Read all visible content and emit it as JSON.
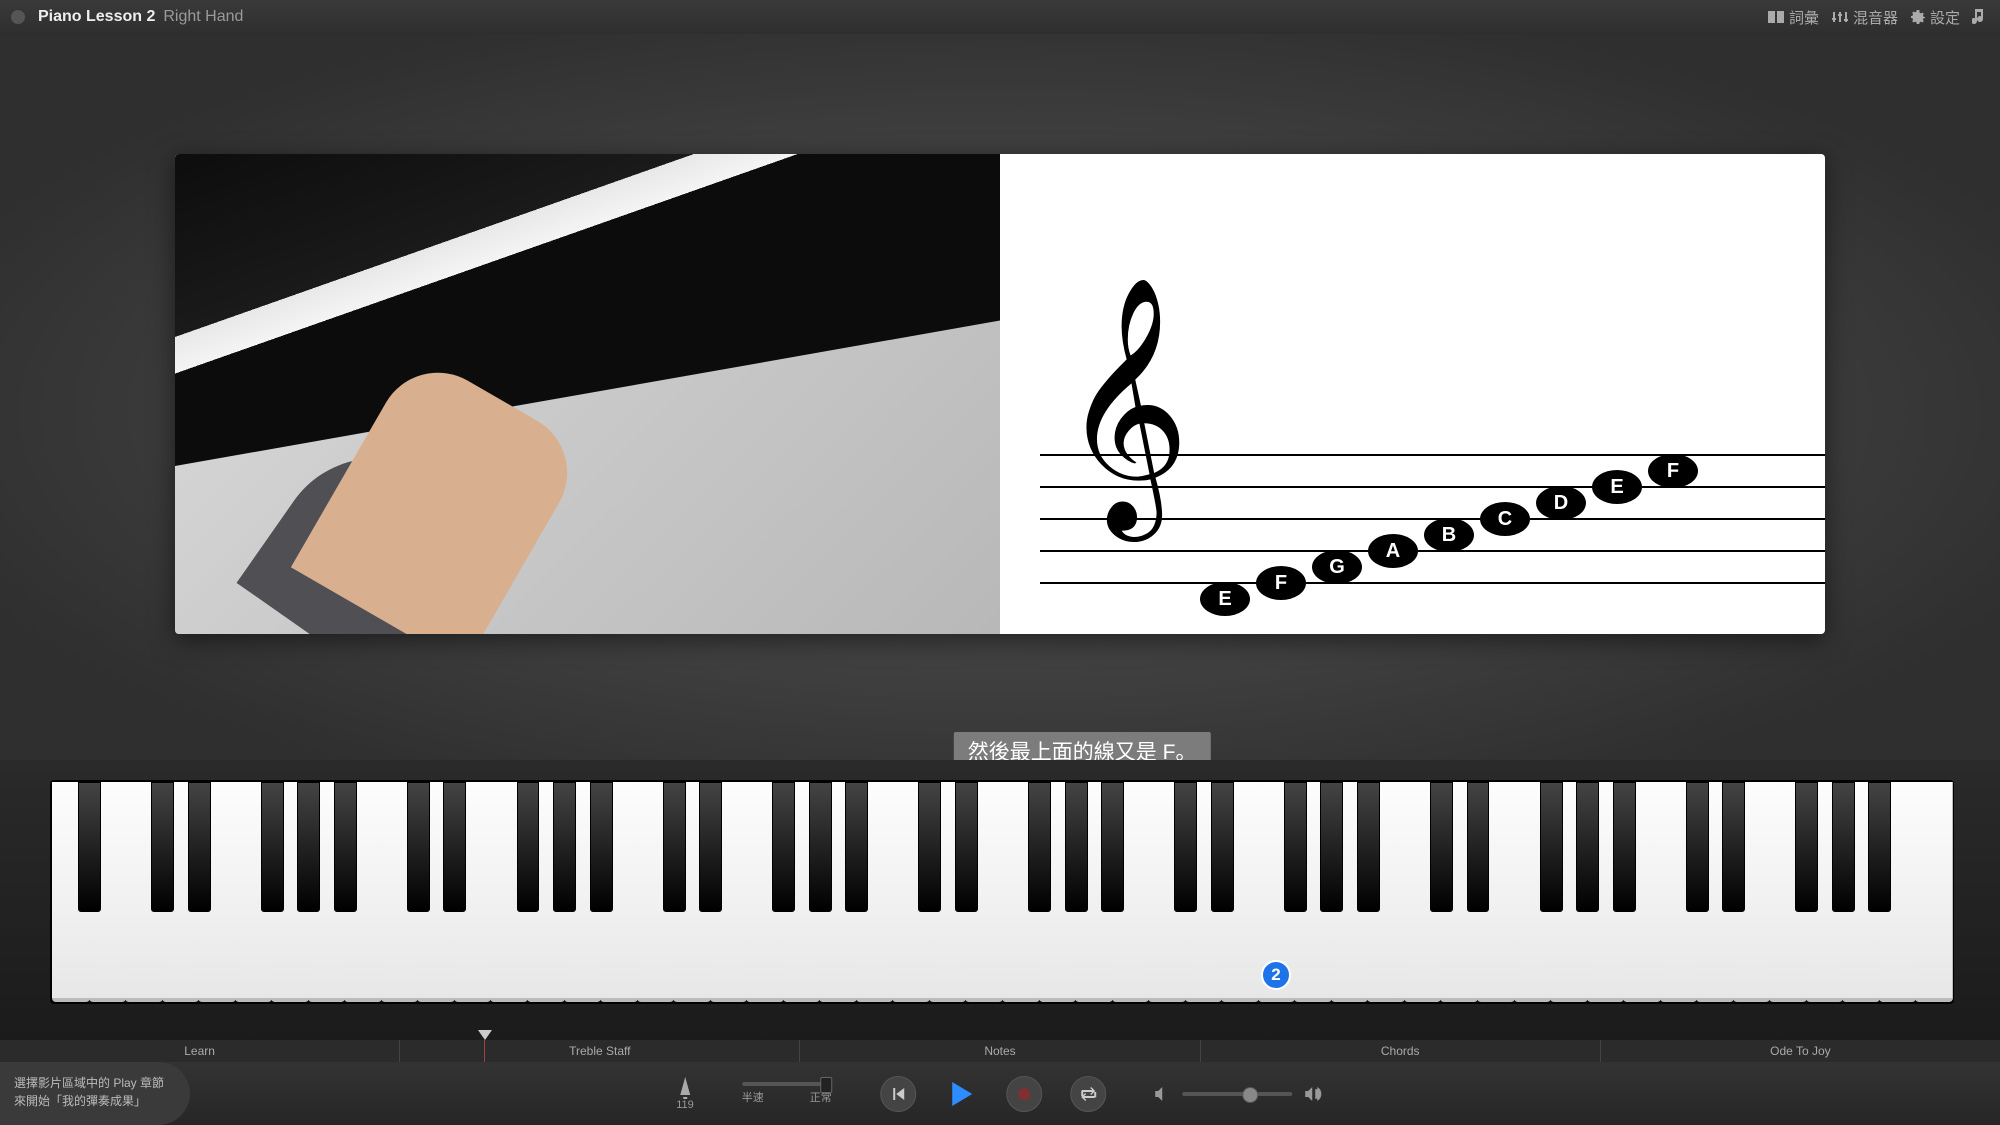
{
  "header": {
    "title": "Piano Lesson 2",
    "subtitle": "Right Hand",
    "menu": {
      "glossary": "詞彙",
      "mixer": "混音器",
      "settings": "設定"
    }
  },
  "subtitle_text": "然後最上面的線又是 F。",
  "notes": [
    "E",
    "F",
    "G",
    "A",
    "B",
    "C",
    "D",
    "E",
    "F"
  ],
  "finger_number": "2",
  "chapters": [
    "Learn",
    "Treble Staff",
    "Notes",
    "Chords",
    "Ode To Joy"
  ],
  "playhead_percent": 24.2,
  "metronome": {
    "bpm": "119",
    "label": "半速"
  },
  "tempo_label": "正常",
  "hint_line1": "選擇影片區域中的 Play 章節",
  "hint_line2": "來開始「我的彈奏成果」"
}
